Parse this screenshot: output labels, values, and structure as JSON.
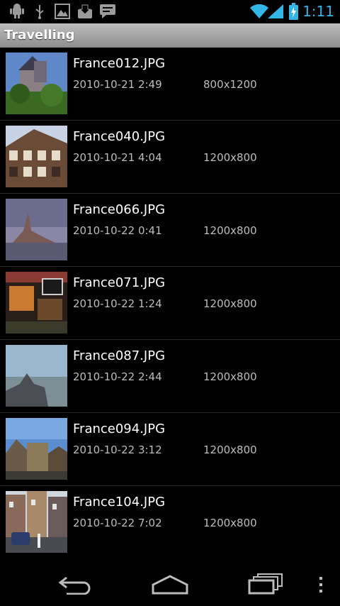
{
  "status_bar": {
    "time": "1:11"
  },
  "action_bar": {
    "title": "Travelling"
  },
  "photos": [
    {
      "name": "France012.JPG",
      "date": "2010-10-21 2:49",
      "dimensions": "800x1200"
    },
    {
      "name": "France040.JPG",
      "date": "2010-10-21 4:04",
      "dimensions": "1200x800"
    },
    {
      "name": "France066.JPG",
      "date": "2010-10-22 0:41",
      "dimensions": "1200x800"
    },
    {
      "name": "France071.JPG",
      "date": "2010-10-22 1:24",
      "dimensions": "1200x800"
    },
    {
      "name": "France087.JPG",
      "date": "2010-10-22 2:44",
      "dimensions": "1200x800"
    },
    {
      "name": "France094.JPG",
      "date": "2010-10-22 3:12",
      "dimensions": "1200x800"
    },
    {
      "name": "France104.JPG",
      "date": "2010-10-22 7:02",
      "dimensions": "1200x800"
    }
  ],
  "icons": {
    "status_left": [
      "android-debug-icon",
      "usb-icon",
      "picture-icon",
      "download-icon",
      "message-icon"
    ],
    "status_right": [
      "wifi-icon",
      "signal-icon",
      "battery-charging-icon"
    ],
    "nav": [
      "back-icon",
      "home-icon",
      "recent-apps-icon",
      "menu-overflow-icon"
    ]
  },
  "colors": {
    "accent": "#33b5e5",
    "action_bar": "#a8a8a8",
    "background": "#000000"
  }
}
